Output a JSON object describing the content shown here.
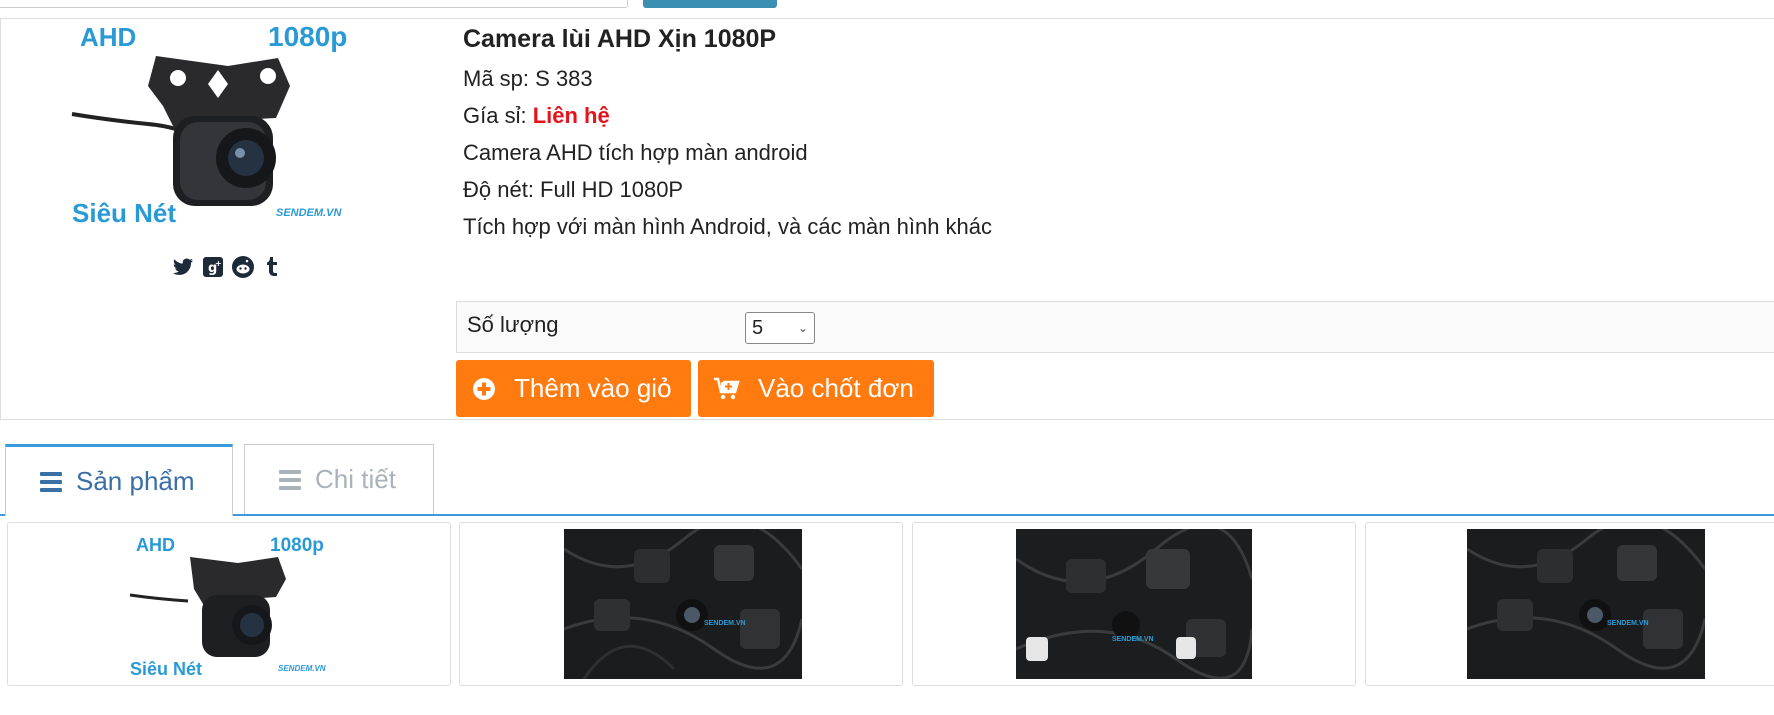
{
  "product": {
    "title": "Camera lùi AHD Xịn 1080P",
    "sku_label": "Mã sp:",
    "sku": "S 383",
    "price_label": "Gía sỉ:",
    "price": "Liên hệ",
    "desc1": "Camera AHD tích hợp màn android",
    "desc2": "Độ nét: Full HD 1080P",
    "desc3": "Tích hợp với màn hình Android, và các màn hình khác",
    "image_text": {
      "ahd": "AHD",
      "res": "1080p",
      "sharp": "Siêu Nét",
      "brand": "SENDEM.VN"
    }
  },
  "social": [
    "twitter-icon",
    "google-plus-icon",
    "reddit-icon",
    "tumblr-icon"
  ],
  "quantity": {
    "label": "Số lượng",
    "value": "5"
  },
  "buttons": {
    "add_to_cart": "Thêm vào giỏ",
    "checkout": "Vào chốt đơn"
  },
  "tabs": [
    {
      "label": "Sản phẩm",
      "active": true
    },
    {
      "label": "Chi tiết",
      "active": false
    }
  ],
  "thumbnails": [
    {
      "ahd": "AHD",
      "res": "1080p",
      "sharp": "Siêu Nét",
      "brand": "SENDEM.VN"
    },
    {
      "brand": "SENDEM.VN"
    },
    {
      "brand": "SENDEM.VN"
    },
    {
      "brand": "SENDEM.VN"
    }
  ],
  "colors": {
    "accent_blue": "#3b9ad9",
    "orange": "#ff7a0f",
    "red": "#e3141c",
    "image_blue": "#2a9ad6"
  }
}
